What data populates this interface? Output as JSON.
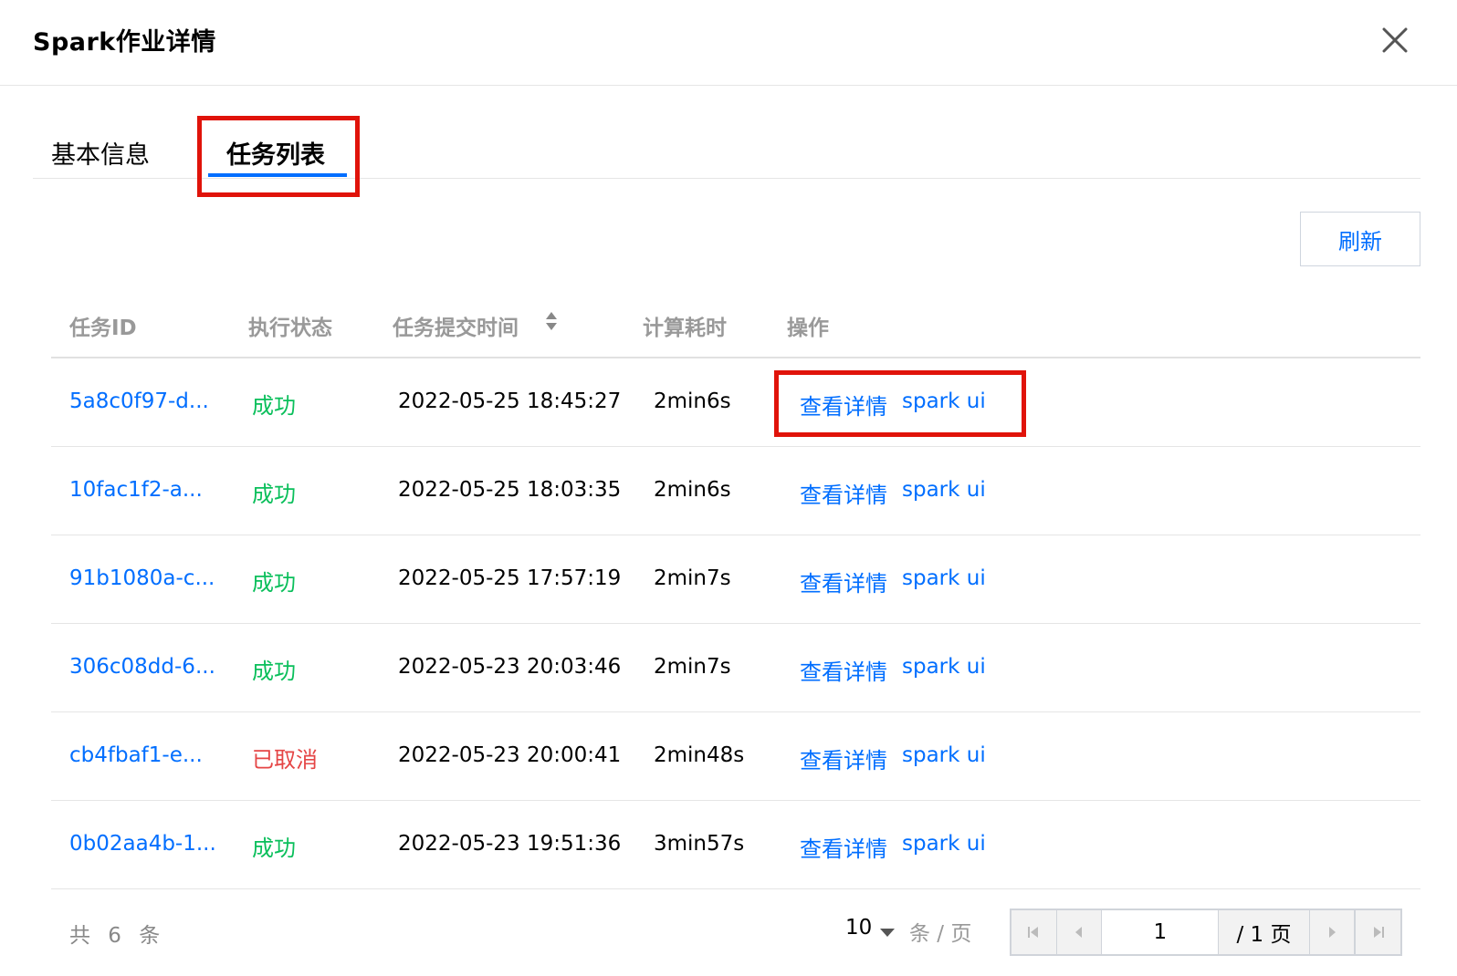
{
  "dialog": {
    "title": "Spark作业详情"
  },
  "tabs": [
    {
      "label": "基本信息"
    },
    {
      "label": "任务列表"
    }
  ],
  "toolbar": {
    "refresh_label": "刷新"
  },
  "table": {
    "columns": [
      "任务ID",
      "执行状态",
      "任务提交时间",
      "计算耗时",
      "操作"
    ],
    "rows": [
      {
        "id": "5a8c0f97-d...",
        "status": "成功",
        "time": "2022-05-25 18:45:27",
        "duration": "2min6s",
        "detail": "查看详情",
        "spark": "spark ui"
      },
      {
        "id": "10fac1f2-a...",
        "status": "成功",
        "time": "2022-05-25 18:03:35",
        "duration": "2min6s",
        "detail": "查看详情",
        "spark": "spark ui"
      },
      {
        "id": "91b1080a-c...",
        "status": "成功",
        "time": "2022-05-25 17:57:19",
        "duration": "2min7s",
        "detail": "查看详情",
        "spark": "spark ui"
      },
      {
        "id": "306c08dd-6...",
        "status": "成功",
        "time": "2022-05-23 20:03:46",
        "duration": "2min7s",
        "detail": "查看详情",
        "spark": "spark ui"
      },
      {
        "id": "cb4fbaf1-e...",
        "status": "已取消",
        "time": "2022-05-23 20:00:41",
        "duration": "2min48s",
        "detail": "查看详情",
        "spark": "spark ui"
      },
      {
        "id": "0b02aa4b-1...",
        "status": "成功",
        "time": "2022-05-23 19:51:36",
        "duration": "3min57s",
        "detail": "查看详情",
        "spark": "spark ui"
      }
    ]
  },
  "pagination": {
    "total_text": "共 6 条",
    "page_size": "10",
    "per_page_text": "条 / 页",
    "current_page": "1",
    "total_pages_text": "/ 1 页"
  },
  "colors": {
    "accent": "#006eff",
    "success": "#0abf5b",
    "cancelled": "#e54545",
    "highlight": "#e0130a"
  },
  "icons": {
    "close": "close-icon",
    "sort": "sort-icon",
    "first_page": "first-page-icon",
    "prev_page": "prev-page-icon",
    "next_page": "next-page-icon",
    "last_page": "last-page-icon"
  }
}
